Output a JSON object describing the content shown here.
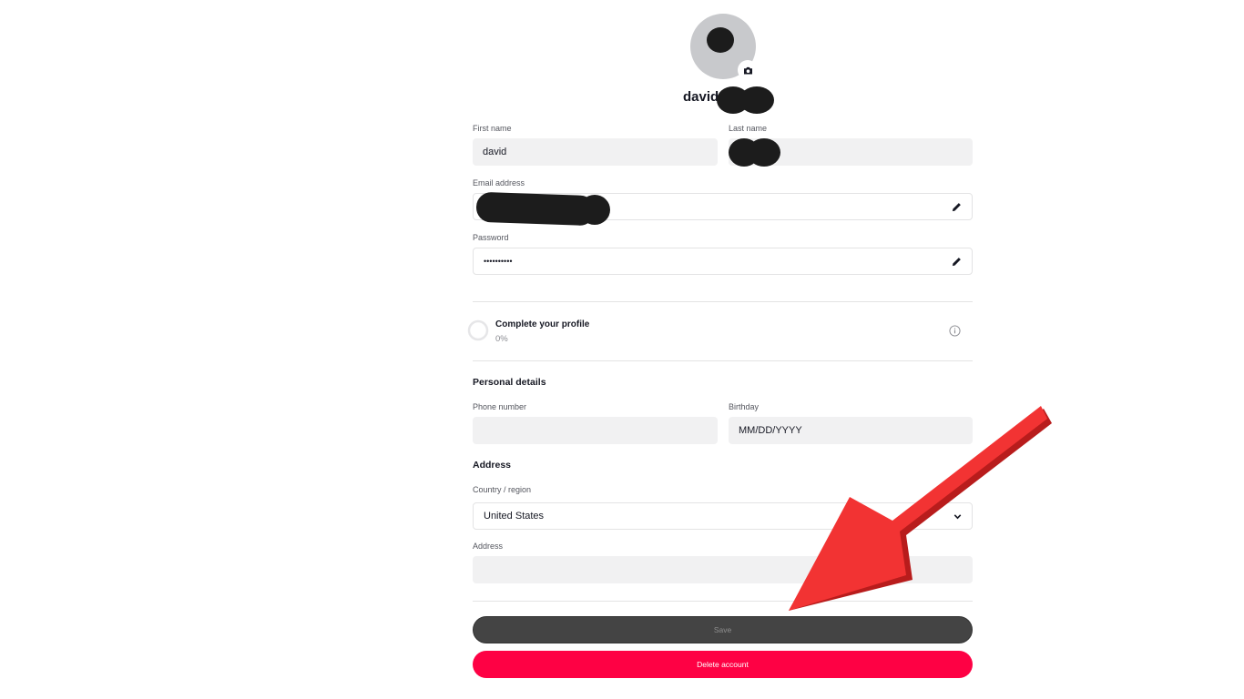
{
  "profile": {
    "avatar_initials": "",
    "display_name": "david"
  },
  "form": {
    "first_name_label": "First name",
    "first_name_value": "david",
    "last_name_label": "Last name",
    "last_name_value": "",
    "email_label": "Email address",
    "email_value": "",
    "password_label": "Password",
    "password_value": "••••••••••"
  },
  "completion": {
    "title": "Complete your profile",
    "percent_text": "0%",
    "percent": 0
  },
  "personal_details": {
    "title": "Personal details",
    "phone_label": "Phone number",
    "phone_value": "",
    "birthday_label": "Birthday",
    "birthday_placeholder": "MM/DD/YYYY"
  },
  "address": {
    "title": "Address",
    "country_label": "Country / region",
    "country_value": "United States",
    "address_label": "Address",
    "address_value": ""
  },
  "buttons": {
    "save": "Save",
    "delete": "Delete account"
  },
  "colors": {
    "accent": "#fe0144",
    "save_bg": "#444444",
    "annotation_arrow": "#f02a2a"
  },
  "icons": [
    "camera-icon",
    "pencil-icon",
    "info-icon",
    "chevron-down-icon",
    "progress-ring-icon"
  ]
}
